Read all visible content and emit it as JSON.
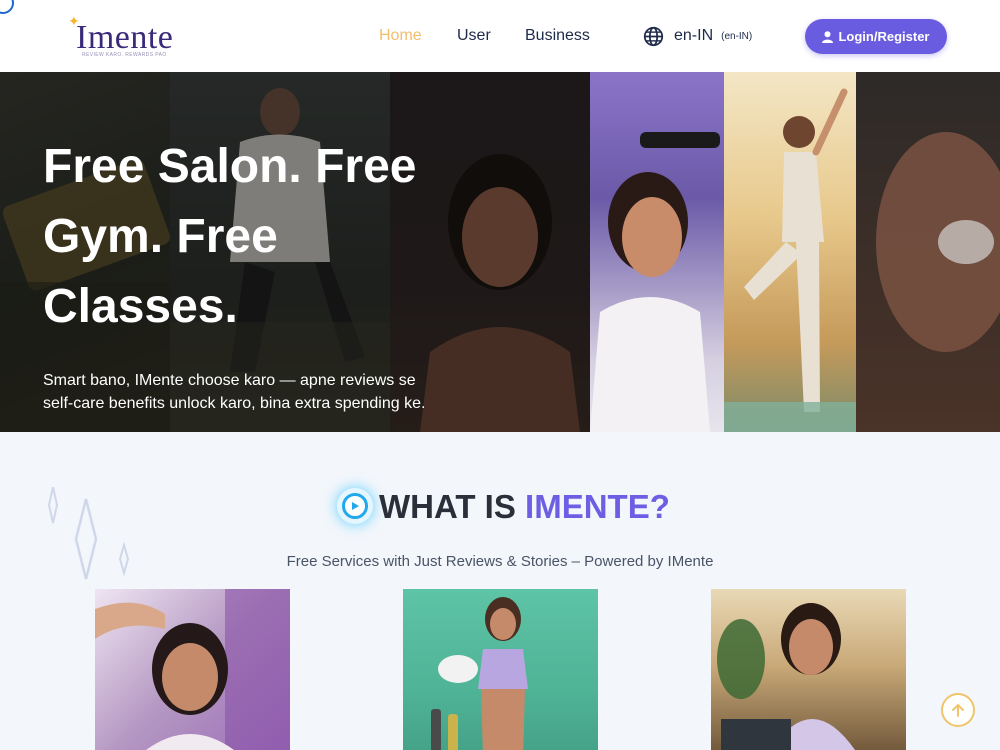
{
  "header": {
    "logo": {
      "text": "Imente",
      "tagline": "REVIEW KARO. REWARDS PAO"
    },
    "nav": [
      {
        "label": "Home",
        "active": true
      },
      {
        "label": "User",
        "active": false
      },
      {
        "label": "Business",
        "active": false
      }
    ],
    "language": {
      "code": "en-IN",
      "sub": "(en-IN)",
      "icon": "globe-icon"
    },
    "login_label": "Login/Register"
  },
  "hero": {
    "title": "Free Salon. Free Gym. Free Classes.",
    "subtitle": "Smart bano, IMente choose karo — apne reviews se self-care benefits unlock karo, bina extra spending ke."
  },
  "section": {
    "title_prefix": "WHAT IS ",
    "title_accent": "IMENTE?",
    "subtitle": "Free Services with Just Reviews & Stories – Powered by IMente"
  },
  "colors": {
    "accent": "#6d5fe3",
    "nav_active": "#f3bd6b",
    "login_bg": "#6a5ce0",
    "text_dark": "#1e2a4a"
  }
}
